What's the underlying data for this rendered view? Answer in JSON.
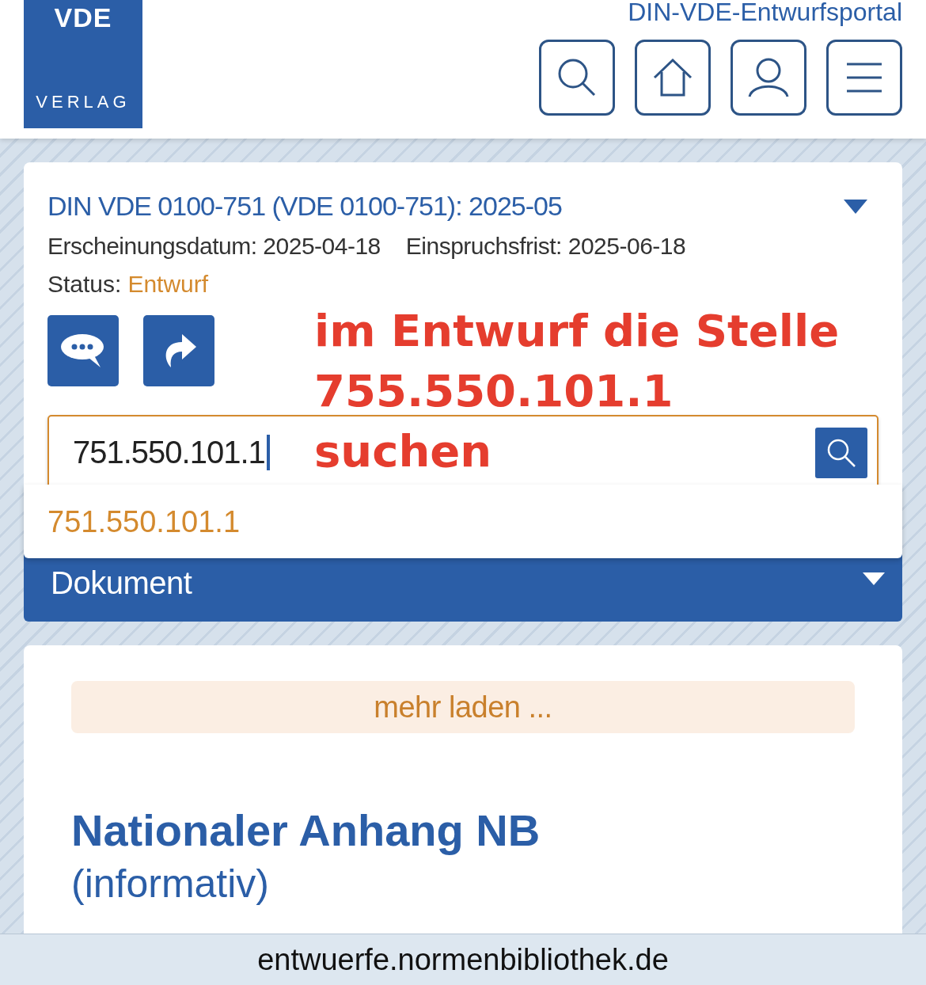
{
  "header": {
    "logo_top": "VDE",
    "logo_bottom": "VERLAG",
    "portal_title": "DIN-VDE-Entwurfsportal"
  },
  "document_card": {
    "title": "DIN VDE 0100-751 (VDE 0100-751): 2025-05",
    "expanded": true,
    "release_label": "Erscheinungsdatum:",
    "release_date": "2025-04-18",
    "deadline_label": "Einspruchsfrist:",
    "deadline_date": "2025-06-18",
    "status_label": "Status:",
    "status_value": "Entwurf"
  },
  "search": {
    "value": "751.550.101.1",
    "suggestions": [
      "751.550.101.1"
    ]
  },
  "annotation": [
    "im Entwurf die Stelle",
    "755.550.101.1",
    "suchen"
  ],
  "section_bar": {
    "label": "Dokument"
  },
  "content": {
    "load_more": "mehr laden ...",
    "heading": "Nationaler Anhang NB",
    "subheading": "(informativ)"
  },
  "url_bar": {
    "url": "entwuerfe.normenbibliothek.de"
  }
}
